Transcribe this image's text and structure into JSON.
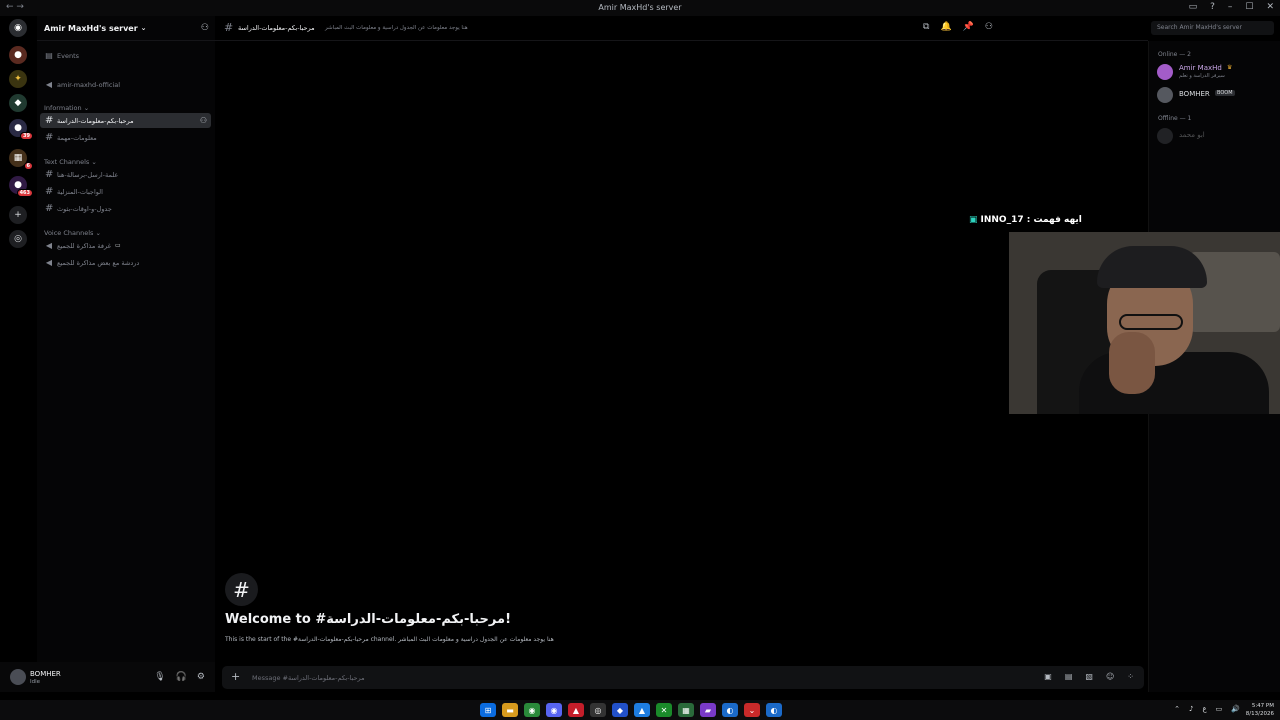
{
  "window": {
    "title": "Amir MaxHd's server"
  },
  "colors": {
    "accent": "#5865f2",
    "background": "#000000",
    "sidebar": "#050506",
    "online": "#23a55a",
    "badge": "#da373c"
  },
  "servers": {
    "badges": [
      "39",
      "6",
      "463"
    ]
  },
  "sidebar": {
    "server_name": "Amir MaxHd's server",
    "events": "Events",
    "official": "amir-maxhd-official",
    "cat_information": "Information",
    "cat_text": "Text Channels",
    "cat_voice": "Voice Channels",
    "info_channels": [
      "مرحبا-بكم-معلومات-الدراسة",
      "معلومات-مهمة"
    ],
    "text_channels": [
      "علمة-ارسل-برسالة-هنا",
      "الواجبات-المنزلية",
      "جدول-و-اوقات-بثوث"
    ],
    "voice_channels": [
      "غرفة مذاكرة للجميع",
      "دردشة مع بعض مذاكرة للجميع"
    ]
  },
  "user": {
    "name": "BOMHER",
    "status": "Idle"
  },
  "chat": {
    "channel_name": "مرحبا-بكم-معلومات-الدراسة",
    "topic": "هنا يوجد معلومات عن الجدول دراسية و معلومات البث المباشر",
    "welcome_title": "Welcome to #مرحبا-بكم-معلومات-الدراسة!",
    "welcome_sub": "This is the start of the #مرحبا-بكم-معلومات-الدراسة channel. هنا يوجد معلومات عن الجدول دراسية و معلومات البث المباشر",
    "composer_placeholder": "Message #مرحبا-بكم-معلومات-الدراسة"
  },
  "search": {
    "placeholder": "Search Amir MaxHd's server"
  },
  "members": {
    "online_header": "Online — 2",
    "offline_header": "Offline — 1",
    "online": [
      {
        "name": "Amir MaxHd",
        "sub": "سيرفر الدراسة و تعلم"
      },
      {
        "name": "BOMHER",
        "tag": "BOOM"
      }
    ],
    "offline": [
      {
        "name": "ابو محمد"
      }
    ]
  },
  "overlay": {
    "label": "INNO_17 : ايهه فهمت"
  },
  "clock": {
    "time": "5:47 PM",
    "date": "8/13/2026"
  }
}
